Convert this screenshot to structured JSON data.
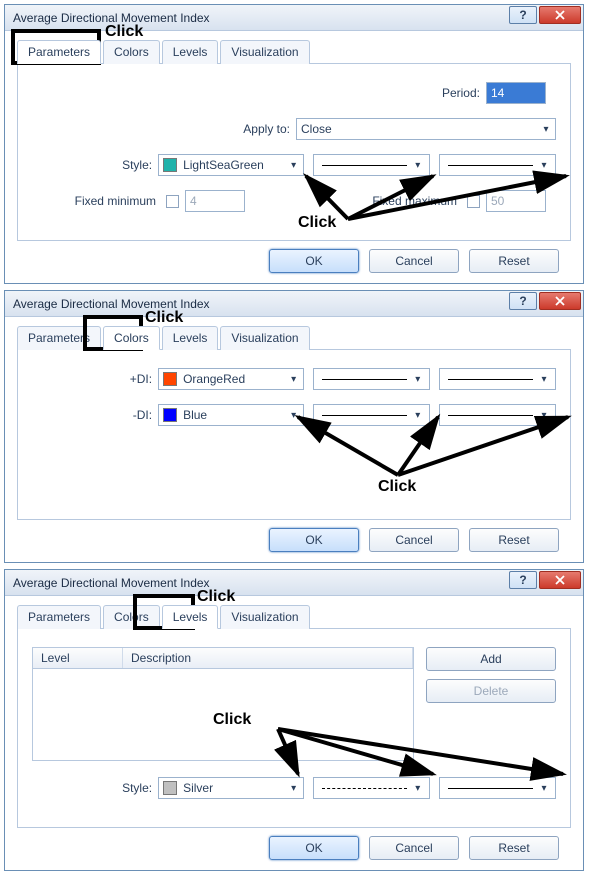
{
  "dlg1": {
    "title": "Average Directional Movement Index",
    "tabs": [
      "Parameters",
      "Colors",
      "Levels",
      "Visualization"
    ],
    "activeTab": 0,
    "period_label": "Period:",
    "period_value": "14",
    "apply_label": "Apply to:",
    "apply_value": "Close",
    "style_label": "Style:",
    "style_value": "LightSeaGreen",
    "style_color": "#20B2AA",
    "fixmin_label": "Fixed minimum",
    "fixmin_value": "4",
    "fixmax_label": "Fixed maximum",
    "fixmax_value": "50",
    "click_label": "Click",
    "ok": "OK",
    "cancel": "Cancel",
    "reset": "Reset"
  },
  "dlg2": {
    "title": "Average Directional Movement Index",
    "tabs": [
      "Parameters",
      "Colors",
      "Levels",
      "Visualization"
    ],
    "activeTab": 1,
    "plusdi_label": "+DI:",
    "plusdi_value": "OrangeRed",
    "plusdi_color": "#FF4500",
    "minusdi_label": "-DI:",
    "minusdi_value": "Blue",
    "minusdi_color": "#0000FF",
    "click_label": "Click",
    "ok": "OK",
    "cancel": "Cancel",
    "reset": "Reset"
  },
  "dlg3": {
    "title": "Average Directional Movement Index",
    "tabs": [
      "Parameters",
      "Colors",
      "Levels",
      "Visualization"
    ],
    "activeTab": 2,
    "col_level": "Level",
    "col_desc": "Description",
    "add": "Add",
    "delete": "Delete",
    "style_label": "Style:",
    "style_value": "Silver",
    "style_color": "#C0C0C0",
    "click_label": "Click",
    "ok": "OK",
    "cancel": "Cancel",
    "reset": "Reset"
  }
}
